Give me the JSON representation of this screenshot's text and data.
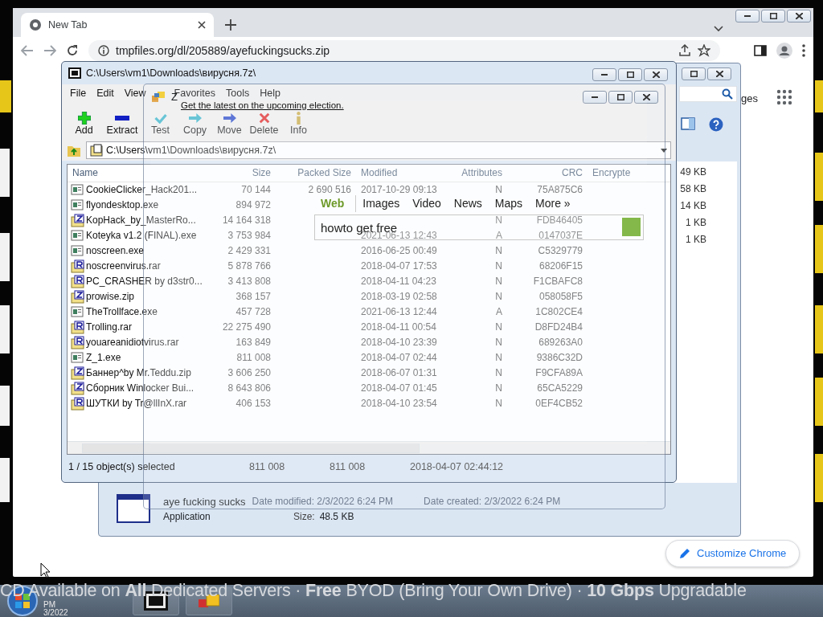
{
  "chrome": {
    "tabs": [
      {
        "label": "New Tab",
        "selected": true
      }
    ],
    "address": "tmpfiles.org/dl/205889/ayefuckingsucks.zip",
    "page_link": "ges",
    "customize": "Customize Chrome"
  },
  "explorer": {
    "sizes": [
      "49 KB",
      "58 KB",
      "14 KB",
      "1 KB",
      "1 KB"
    ],
    "details": {
      "name": "aye fucking sucks",
      "modified": "Date modified: 2/3/2022 6:24 PM",
      "created": "Date created: 2/3/2022 6:24 PM",
      "type": "Application",
      "size_label": "Size:",
      "size": "48.5 KB"
    }
  },
  "archiver": {
    "title": "C:\\Users\\vm1\\Downloads\\вирусня.7z\\",
    "menu": [
      "File",
      "Edit",
      "View",
      "Favorites",
      "Tools",
      "Help"
    ],
    "toolbar": [
      {
        "label": "Add",
        "kind": "add"
      },
      {
        "label": "Extract",
        "kind": "extract"
      },
      {
        "label": "Test",
        "kind": "test"
      },
      {
        "label": "Copy",
        "kind": "copy"
      },
      {
        "label": "Move",
        "kind": "move"
      },
      {
        "label": "Delete",
        "kind": "delete"
      },
      {
        "label": "Info",
        "kind": "info"
      }
    ],
    "path": "C:\\Users\\vm1\\Downloads\\вирусня.7z\\",
    "columns": [
      "Name",
      "Size",
      "Packed Size",
      "Modified",
      "Attributes",
      "CRC",
      "Encrypte"
    ],
    "rows": [
      {
        "kind": "exe",
        "name": "CookieClicker_Hack201...",
        "size": "70 144",
        "packed": "2 690 516",
        "modified": "2017-10-29 09:13",
        "attributes": "N",
        "crc": "75A875C6"
      },
      {
        "kind": "exe",
        "name": "flyondesktop.exe",
        "size": "894 972"
      },
      {
        "kind": "zip",
        "name": "KopHack_by_MasterRo...",
        "size": "14 164 318",
        "attributes": "N",
        "crc": "FDB46405"
      },
      {
        "kind": "exe",
        "name": "Koteyka v1.2 (FINAL).exe",
        "size": "3 753 984",
        "modified": "2021-06-13 12:43",
        "attributes": "A",
        "crc": "0147037E"
      },
      {
        "kind": "exe",
        "name": "noscreen.exe",
        "size": "2 429 331",
        "modified": "2016-06-25 00:49",
        "attributes": "N",
        "crc": "C5329779"
      },
      {
        "kind": "rar",
        "name": "noscreenvirus.rar",
        "size": "5 878 766",
        "modified": "2018-04-07 17:53",
        "attributes": "N",
        "crc": "68206F15"
      },
      {
        "kind": "rar",
        "name": "PC_CRASHER by d3str0...",
        "size": "3 413 808",
        "modified": "2018-04-11 04:23",
        "attributes": "N",
        "crc": "F1CBAFC8"
      },
      {
        "kind": "zip",
        "name": "prowise.zip",
        "size": "368 157",
        "modified": "2018-03-19 02:58",
        "attributes": "N",
        "crc": "058058F5"
      },
      {
        "kind": "exe",
        "name": "TheTrollface.exe",
        "size": "457 728",
        "modified": "2021-06-13 12:44",
        "attributes": "A",
        "crc": "1C802CE4"
      },
      {
        "kind": "rar",
        "name": "Trolling.rar",
        "size": "22 275 490",
        "modified": "2018-04-11 00:54",
        "attributes": "N",
        "crc": "D8FD24B4"
      },
      {
        "kind": "rar",
        "name": "youareanidiotvirus.rar",
        "size": "163 849",
        "modified": "2018-04-10 23:39",
        "attributes": "N",
        "crc": "689263A0"
      },
      {
        "kind": "exe",
        "name": "Z_1.exe",
        "size": "811 008",
        "modified": "2018-04-07 02:44",
        "attributes": "N",
        "crc": "9386C32D"
      },
      {
        "kind": "zip",
        "name": "Баннер^by Mr.Teddu.zip",
        "size": "3 606 250",
        "modified": "2018-06-07 01:31",
        "attributes": "N",
        "crc": "F9CFA89A"
      },
      {
        "kind": "zip",
        "name": "Сборник Winlocker Bui...",
        "size": "8 643 806",
        "modified": "2018-04-07 01:45",
        "attributes": "N",
        "crc": "65CA5229"
      },
      {
        "kind": "rar",
        "name": "ШУТКИ by Tr@llInX.rar",
        "size": "406 153",
        "modified": "2018-04-10 23:54",
        "attributes": "N",
        "crc": "0EF4CB52"
      }
    ],
    "status": [
      "1 / 15 object(s) selected",
      "811 008",
      "811 008",
      "2018-04-07 02:44:12"
    ]
  },
  "popup": {
    "title": "Z",
    "link": "Get the latest on the upcoming election.",
    "search_tabs": [
      {
        "label": "Web",
        "selected": true
      },
      {
        "label": "Images",
        "selected": false
      },
      {
        "label": "Video",
        "selected": false
      },
      {
        "label": "News",
        "selected": false
      },
      {
        "label": "Maps",
        "selected": false
      },
      {
        "label": "More »",
        "selected": false
      }
    ],
    "query": "howto get free"
  },
  "ticker": "CD Available on **All** Dedicated Servers · **Free** BYOD (Bring Your Own Drive) · **10 Gbps** Upgradable",
  "taskbar": {
    "clock": [
      "PM",
      "3/2022"
    ]
  }
}
